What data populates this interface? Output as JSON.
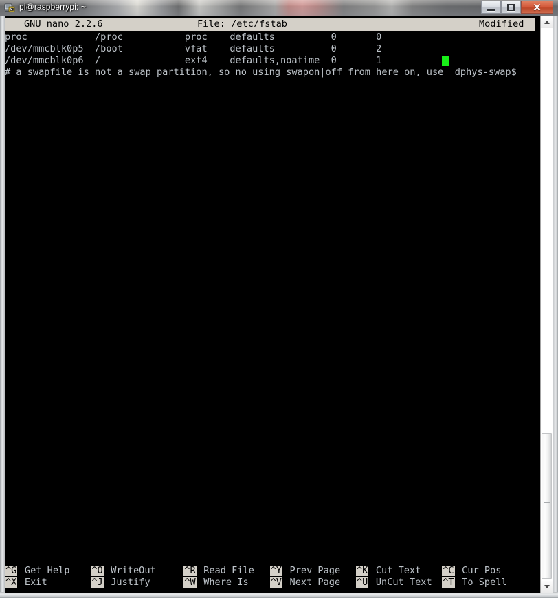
{
  "window": {
    "title": "pi@raspberrypi: ~",
    "icon": "putty-terminal-icon",
    "controls": {
      "minimize": "minimize-icon",
      "maximize": "maximize-icon",
      "close": "✕"
    }
  },
  "nano": {
    "version_label": "GNU nano 2.2.6",
    "file_label": "File: /etc/fstab",
    "modified_label": "Modified",
    "lines": [
      {
        "text": "proc            /proc           proc    defaults          0       0",
        "has_cursor": false
      },
      {
        "text": "/dev/mmcblk0p5  /boot           vfat    defaults          0       2",
        "has_cursor": false
      },
      {
        "text": "/dev/mmcblk0p6  /               ext4    defaults,noatime  0       1",
        "has_cursor": true,
        "cursor_col": 66
      },
      {
        "text": "# a swapfile is not a swap partition, so no using swapon|off from here on, use  dphys-swap$",
        "has_cursor": false
      }
    ],
    "cursor_color": "#18f018",
    "text_color": "#bdc3c9",
    "background_color": "#000000",
    "inverse_background": "#d4d0c8",
    "shortcuts": [
      {
        "key": "^G",
        "label": "Get Help",
        "col": 0,
        "row": 0
      },
      {
        "key": "^X",
        "label": "Exit",
        "col": 0,
        "row": 1
      },
      {
        "key": "^O",
        "label": "WriteOut",
        "col": 13,
        "row": 0
      },
      {
        "key": "^J",
        "label": "Justify",
        "col": 13,
        "row": 1
      },
      {
        "key": "^R",
        "label": "Read File",
        "col": 27,
        "row": 0
      },
      {
        "key": "^W",
        "label": "Where Is",
        "col": 27,
        "row": 1
      },
      {
        "key": "^Y",
        "label": "Prev Page",
        "col": 40,
        "row": 0
      },
      {
        "key": "^V",
        "label": "Next Page",
        "col": 40,
        "row": 1
      },
      {
        "key": "^K",
        "label": "Cut Text",
        "col": 53,
        "row": 0
      },
      {
        "key": "^U",
        "label": "UnCut Text",
        "col": 53,
        "row": 1
      },
      {
        "key": "^C",
        "label": "Cur Pos",
        "col": 66,
        "row": 0
      },
      {
        "key": "^T",
        "label": "To Spell",
        "col": 66,
        "row": 1
      }
    ]
  },
  "scrollbar": {
    "up_arrow": "scroll-up-arrow-icon",
    "down_arrow": "scroll-down-arrow-icon",
    "thumb": "scrollbar-thumb"
  }
}
